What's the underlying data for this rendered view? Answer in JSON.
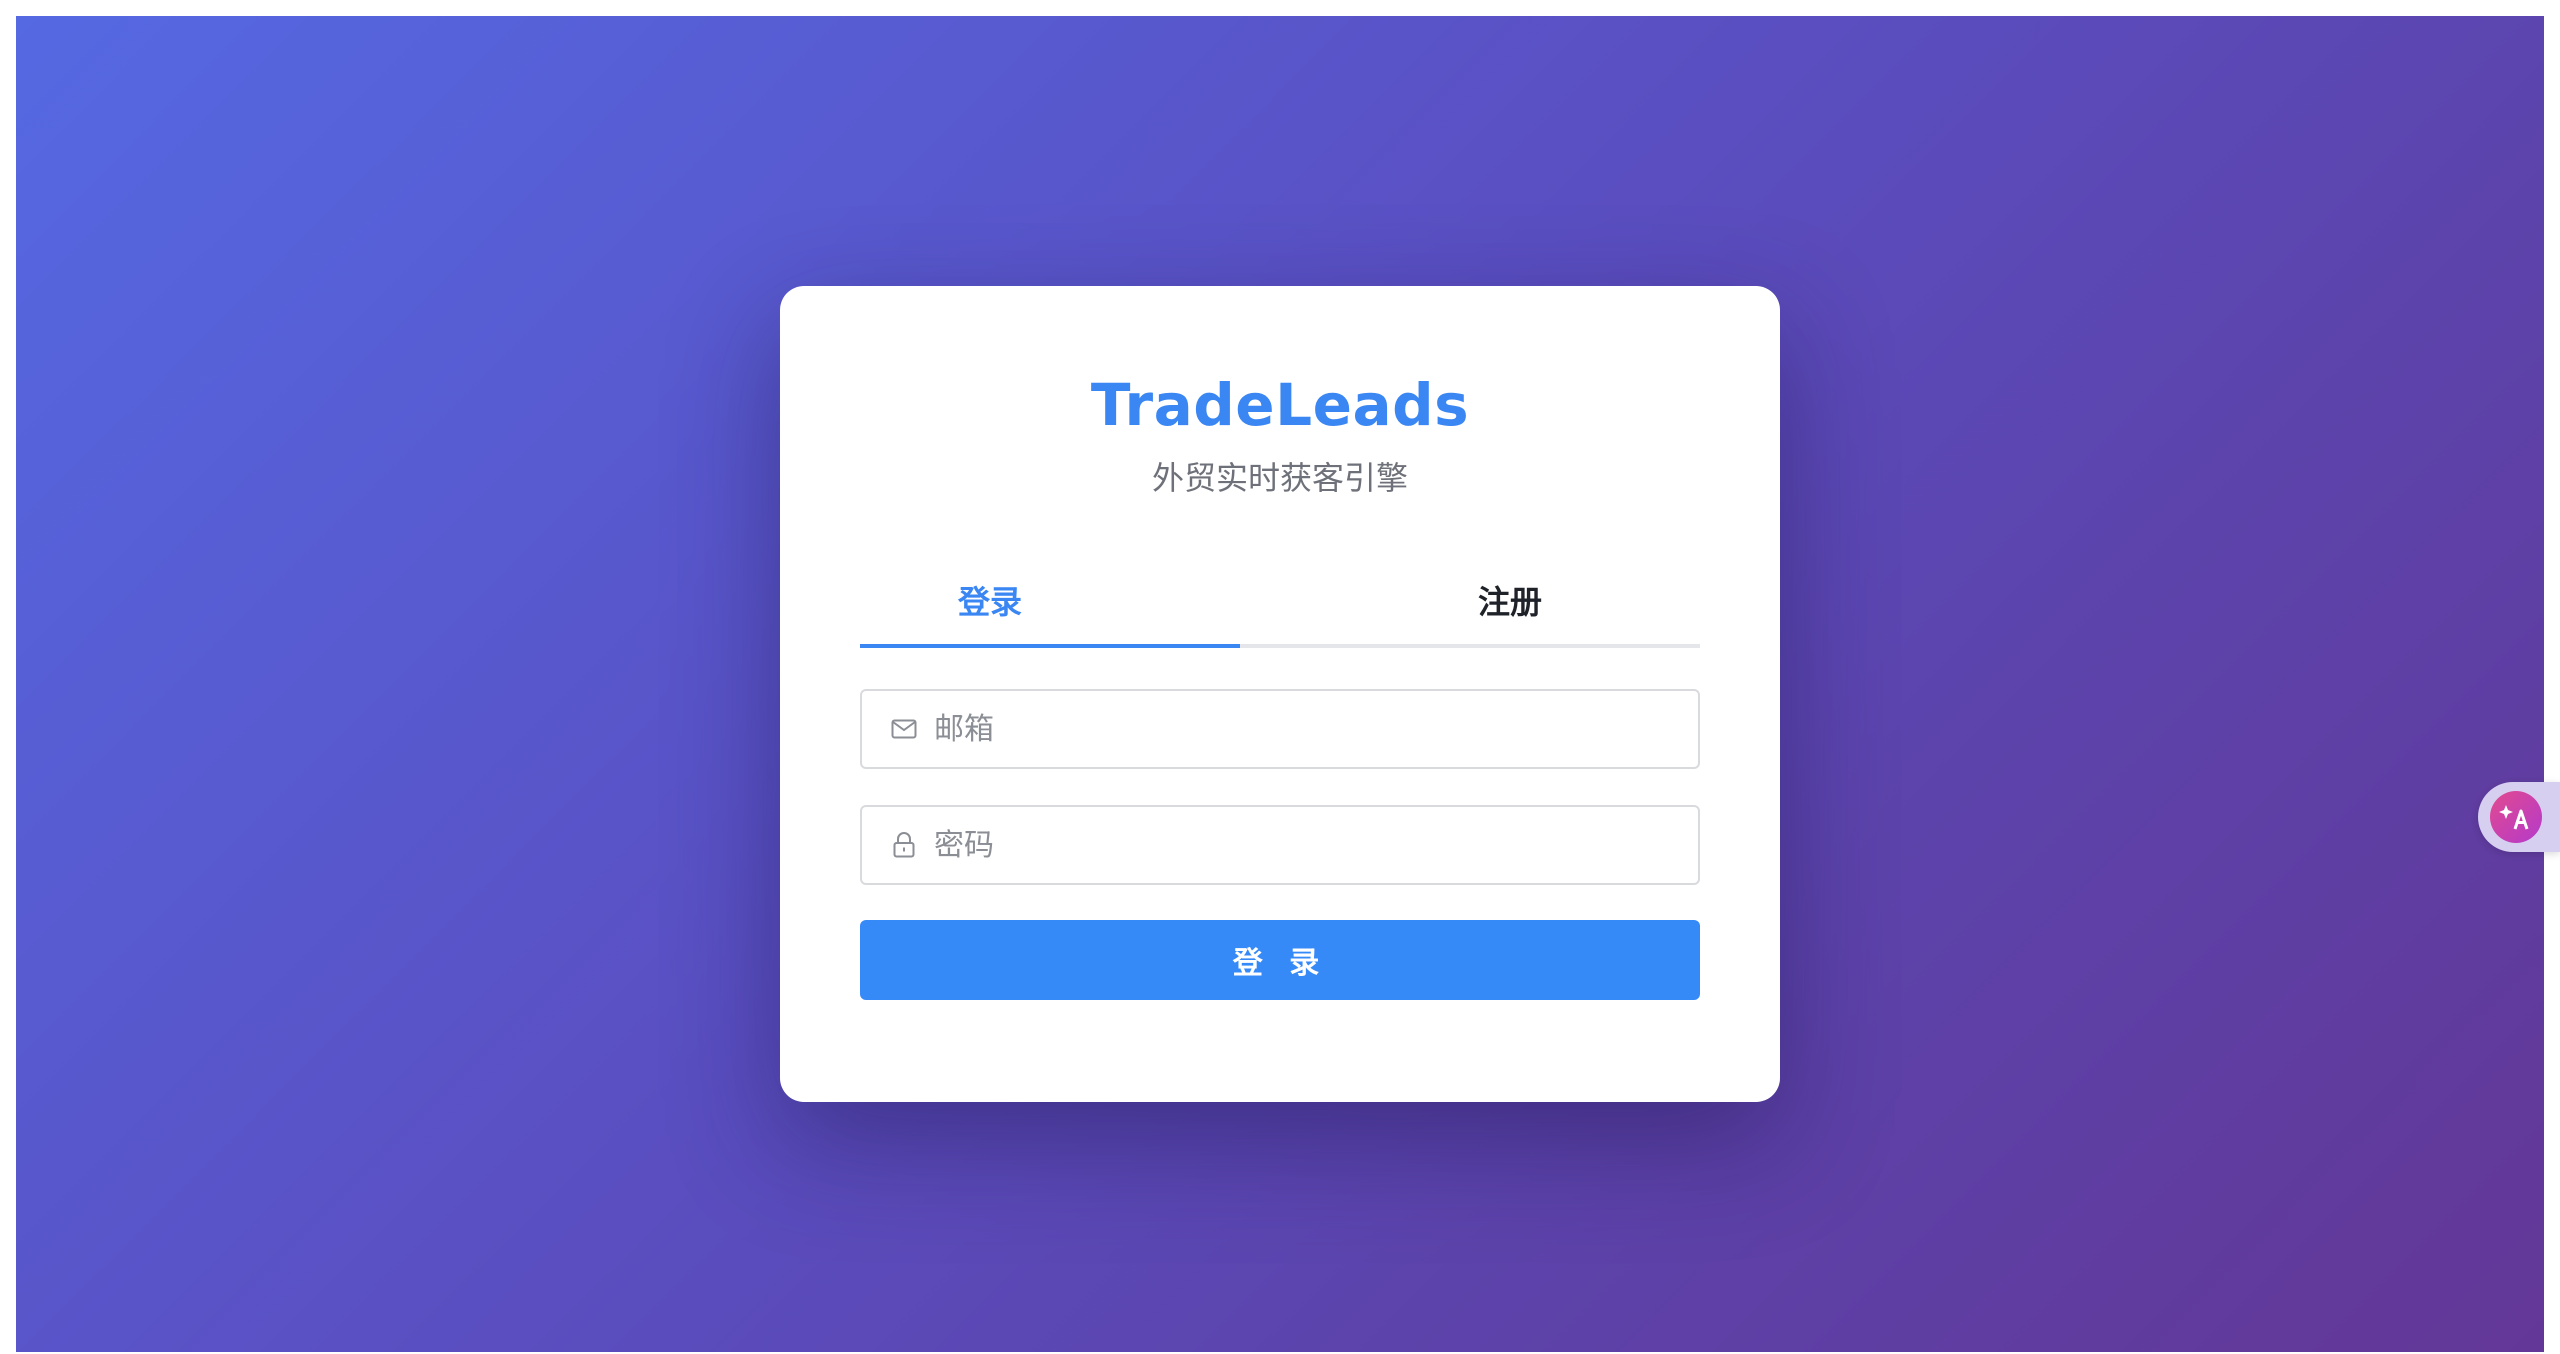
{
  "brand": {
    "title": "TradeLeads",
    "slogan": "外贸实时获客引擎"
  },
  "tabs": [
    {
      "label": "登录",
      "active": true
    },
    {
      "label": "注册",
      "active": false
    }
  ],
  "form": {
    "email_placeholder": "邮箱",
    "email_value": "",
    "password_placeholder": "密码",
    "password_value": "",
    "submit_label": "登 录"
  },
  "icons": {
    "email": "mail-icon",
    "password": "lock-icon",
    "translate": "translate-icon"
  },
  "colors": {
    "accent": "#3a86f3",
    "button": "#368af7",
    "background_start": "#5569e2",
    "background_end": "#633797"
  }
}
